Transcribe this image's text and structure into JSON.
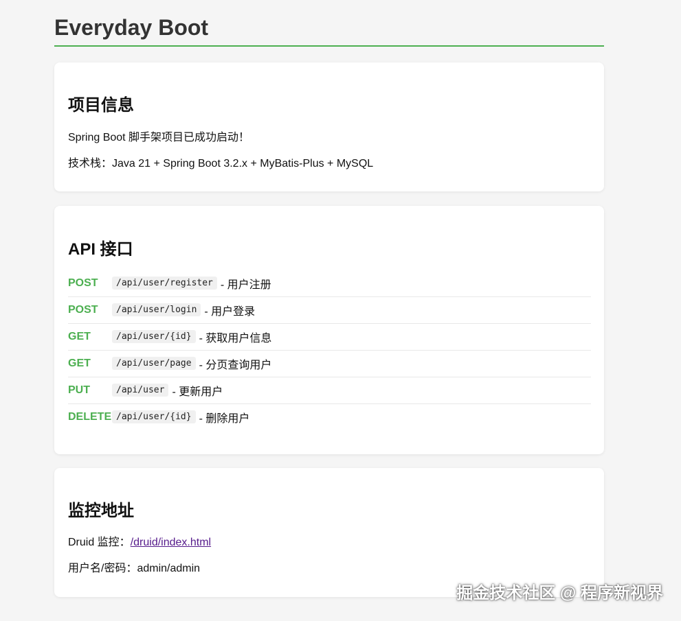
{
  "title": "Everyday Boot",
  "info": {
    "heading": "项目信息",
    "line1": "Spring Boot 脚手架项目已成功启动！",
    "line2": "技术栈：Java 21 + Spring Boot 3.2.x + MyBatis-Plus + MySQL"
  },
  "api": {
    "heading": "API 接口",
    "rows": [
      {
        "method": "POST",
        "path": "/api/user/register",
        "desc": "- 用户注册"
      },
      {
        "method": "POST",
        "path": "/api/user/login",
        "desc": "- 用户登录"
      },
      {
        "method": "GET",
        "path": "/api/user/{id}",
        "desc": "- 获取用户信息"
      },
      {
        "method": "GET",
        "path": "/api/user/page",
        "desc": "- 分页查询用户"
      },
      {
        "method": "PUT",
        "path": "/api/user",
        "desc": "- 更新用户"
      },
      {
        "method": "DELETE",
        "path": "/api/user/{id}",
        "desc": "- 删除用户"
      }
    ]
  },
  "monitor": {
    "heading": "监控地址",
    "druid_label": "Druid 监控：",
    "druid_link": "/druid/index.html",
    "credentials": "用户名/密码：admin/admin"
  },
  "watermark": "掘金技术社区 @ 程序新视界",
  "colors": {
    "accent": "#4caf50",
    "link": "#551a8b",
    "background": "#f5f5f5"
  }
}
